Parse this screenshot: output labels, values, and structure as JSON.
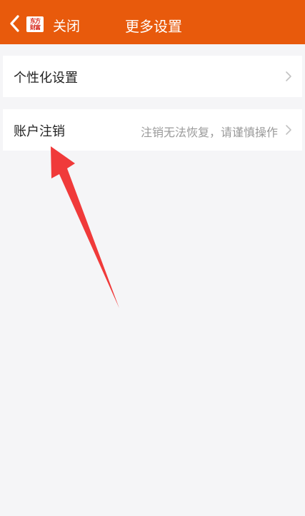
{
  "header": {
    "back_icon": "chevron-left-icon",
    "logo_top": "东方",
    "logo_bottom": "财富",
    "close_label": "关闭",
    "title": "更多设置",
    "bar_color": "#e85a0c"
  },
  "settings": {
    "items": [
      {
        "label": "个性化设置",
        "hint": "",
        "icon": "chevron-right-icon"
      },
      {
        "label": "账户注销",
        "hint": "注销无法恢复，请谨慎操作",
        "icon": "chevron-right-icon"
      }
    ]
  },
  "annotation": {
    "icon": "red-arrow-icon",
    "color": "#f03a3a"
  }
}
